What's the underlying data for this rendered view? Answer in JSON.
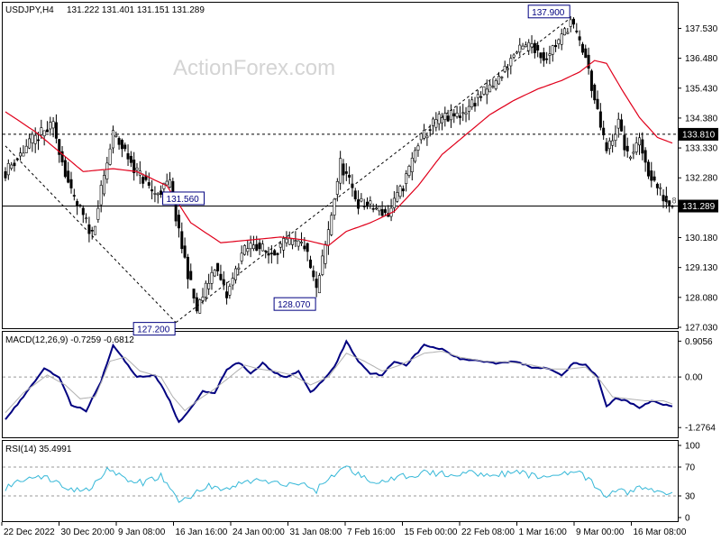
{
  "header": {
    "symbol": "USDJPY,H4",
    "ohlc": "131.222 131.401 131.151 131.289"
  },
  "watermark": "ActionForex.com",
  "colors": {
    "candle": "#000000",
    "ma": "#e0001b",
    "macd": "#000080",
    "signal": "#b0b0b0",
    "rsi": "#36b8d8",
    "label_border": "#000080",
    "badge_bg": "#000000",
    "badge_text": "#ffffff"
  },
  "chart_data": [
    {
      "type": "candlestick",
      "title": "USDJPY,H4 131.222 131.401 131.151 131.289",
      "x_tick_labels": [
        "22 Dec 2022",
        "30 Dec 20:00",
        "9 Jan 08:00",
        "16 Jan 16:00",
        "24 Jan 00:00",
        "31 Jan 08:00",
        "7 Feb 16:00",
        "15 Feb 00:00",
        "22 Feb 08:00",
        "1 Mar 16:00",
        "9 Mar 00:00",
        "16 Mar 08:00"
      ],
      "y_tick_labels": [
        "137.530",
        "136.480",
        "135.430",
        "134.380",
        "133.330",
        "132.280",
        "131.230",
        "130.180",
        "129.130",
        "128.080",
        "127.030"
      ],
      "ylim": [
        127.03,
        138.4
      ],
      "price_path_anchors": [
        [
          0,
          132.5
        ],
        [
          9,
          133.6
        ],
        [
          16,
          134.1
        ],
        [
          22,
          131.7
        ],
        [
          29,
          130.3
        ],
        [
          36,
          133.8
        ],
        [
          40,
          133.2
        ],
        [
          44,
          132.5
        ],
        [
          50,
          131.7
        ],
        [
          55,
          132.1
        ],
        [
          58,
          130.3
        ],
        [
          64,
          127.6
        ],
        [
          70,
          129.2
        ],
        [
          74,
          128.1
        ],
        [
          79,
          129.6
        ],
        [
          83,
          130.0
        ],
        [
          88,
          129.6
        ],
        [
          94,
          130.0
        ],
        [
          100,
          129.9
        ],
        [
          104,
          128.3
        ],
        [
          108,
          130.4
        ],
        [
          112,
          132.8
        ],
        [
          118,
          131.4
        ],
        [
          124,
          131.2
        ],
        [
          128,
          131.0
        ],
        [
          133,
          132.0
        ],
        [
          138,
          133.5
        ],
        [
          144,
          134.3
        ],
        [
          152,
          134.5
        ],
        [
          158,
          135.1
        ],
        [
          164,
          135.6
        ],
        [
          170,
          136.6
        ],
        [
          176,
          137.0
        ],
        [
          180,
          136.5
        ],
        [
          186,
          137.2
        ],
        [
          189,
          137.8
        ],
        [
          194,
          136.5
        ],
        [
          198,
          134.5
        ],
        [
          201,
          133.2
        ],
        [
          205,
          134.2
        ],
        [
          208,
          133.0
        ],
        [
          212,
          133.5
        ],
        [
          215,
          132.5
        ],
        [
          220,
          131.6
        ],
        [
          223,
          131.289
        ]
      ],
      "moving_average": {
        "anchors": [
          [
            0,
            134.6
          ],
          [
            10,
            133.9
          ],
          [
            18,
            133.2
          ],
          [
            26,
            132.5
          ],
          [
            36,
            132.6
          ],
          [
            44,
            132.5
          ],
          [
            54,
            132.0
          ],
          [
            62,
            130.7
          ],
          [
            72,
            130.0
          ],
          [
            82,
            130.1
          ],
          [
            92,
            130.2
          ],
          [
            100,
            130.1
          ],
          [
            108,
            129.9
          ],
          [
            114,
            130.4
          ],
          [
            122,
            130.7
          ],
          [
            130,
            131.1
          ],
          [
            138,
            132.0
          ],
          [
            146,
            133.1
          ],
          [
            154,
            133.8
          ],
          [
            162,
            134.5
          ],
          [
            170,
            135.0
          ],
          [
            178,
            135.4
          ],
          [
            186,
            135.7
          ],
          [
            192,
            136.0
          ],
          [
            197,
            136.4
          ],
          [
            201,
            136.3
          ],
          [
            206,
            135.4
          ],
          [
            212,
            134.4
          ],
          [
            218,
            133.7
          ],
          [
            223,
            133.5
          ]
        ]
      },
      "horizontal_levels": [
        {
          "value": 133.81,
          "label": "133.810",
          "style": "dashed"
        },
        {
          "value": 131.289,
          "label": "131.289",
          "style": "solid"
        }
      ],
      "trendlines": [
        {
          "from": [
            0,
            133.4
          ],
          "to": [
            57,
            127.2
          ]
        },
        {
          "from": [
            57,
            127.2
          ],
          "to": [
            189,
            137.9
          ]
        }
      ],
      "annotations": [
        {
          "bar": 189,
          "value": 137.9,
          "text": "137.900",
          "pos": "above-left"
        },
        {
          "bar": 52,
          "value": 131.56,
          "text": "131.560",
          "pos": "right"
        },
        {
          "bar": 57,
          "value": 127.2,
          "text": "127.200",
          "pos": "below-left"
        },
        {
          "bar": 104,
          "value": 128.07,
          "text": "128.070",
          "pos": "below-left"
        }
      ],
      "right_edge_note": "1.8"
    },
    {
      "type": "line",
      "title": "MACD(12,26,9) -0.7259 -0.6812",
      "y_tick_labels": [
        "0.9056",
        "0.00",
        "-1.2764"
      ],
      "ylim": [
        -1.5,
        1.05
      ],
      "zero_line": 0.0,
      "series": [
        {
          "name": "MACD",
          "anchors": [
            [
              0,
              -1.05
            ],
            [
              5,
              -0.6
            ],
            [
              13,
              0.22
            ],
            [
              18,
              0.0
            ],
            [
              22,
              -0.7
            ],
            [
              27,
              -0.85
            ],
            [
              32,
              -0.1
            ],
            [
              36,
              0.8
            ],
            [
              40,
              0.4
            ],
            [
              44,
              0.0
            ],
            [
              50,
              0.05
            ],
            [
              55,
              -0.6
            ],
            [
              58,
              -1.15
            ],
            [
              62,
              -0.8
            ],
            [
              66,
              -0.35
            ],
            [
              70,
              -0.4
            ],
            [
              74,
              0.2
            ],
            [
              78,
              0.37
            ],
            [
              82,
              0.1
            ],
            [
              86,
              0.35
            ],
            [
              90,
              0.1
            ],
            [
              94,
              0.0
            ],
            [
              98,
              0.15
            ],
            [
              102,
              -0.4
            ],
            [
              106,
              -0.1
            ],
            [
              110,
              0.25
            ],
            [
              114,
              0.9
            ],
            [
              118,
              0.4
            ],
            [
              122,
              0.1
            ],
            [
              126,
              0.05
            ],
            [
              130,
              0.4
            ],
            [
              134,
              0.3
            ],
            [
              140,
              0.8
            ],
            [
              146,
              0.7
            ],
            [
              152,
              0.45
            ],
            [
              158,
              0.42
            ],
            [
              164,
              0.35
            ],
            [
              170,
              0.4
            ],
            [
              176,
              0.25
            ],
            [
              182,
              0.22
            ],
            [
              186,
              0.05
            ],
            [
              190,
              0.35
            ],
            [
              194,
              0.3
            ],
            [
              198,
              0.0
            ],
            [
              201,
              -0.75
            ],
            [
              204,
              -0.55
            ],
            [
              208,
              -0.6
            ],
            [
              212,
              -0.8
            ],
            [
              216,
              -0.6
            ],
            [
              220,
              -0.7
            ],
            [
              223,
              -0.73
            ]
          ]
        },
        {
          "name": "Signal",
          "anchors": [
            [
              0,
              -0.9
            ],
            [
              6,
              -0.4
            ],
            [
              14,
              0.05
            ],
            [
              20,
              -0.2
            ],
            [
              25,
              -0.55
            ],
            [
              30,
              -0.5
            ],
            [
              35,
              0.4
            ],
            [
              40,
              0.5
            ],
            [
              45,
              0.15
            ],
            [
              52,
              0.0
            ],
            [
              56,
              -0.5
            ],
            [
              60,
              -0.85
            ],
            [
              65,
              -0.55
            ],
            [
              70,
              -0.3
            ],
            [
              75,
              0.0
            ],
            [
              80,
              0.3
            ],
            [
              85,
              0.2
            ],
            [
              90,
              0.15
            ],
            [
              96,
              0.05
            ],
            [
              102,
              -0.2
            ],
            [
              108,
              0.0
            ],
            [
              114,
              0.6
            ],
            [
              120,
              0.4
            ],
            [
              126,
              0.15
            ],
            [
              132,
              0.3
            ],
            [
              140,
              0.6
            ],
            [
              146,
              0.65
            ],
            [
              152,
              0.5
            ],
            [
              160,
              0.4
            ],
            [
              168,
              0.38
            ],
            [
              176,
              0.3
            ],
            [
              182,
              0.2
            ],
            [
              188,
              0.2
            ],
            [
              194,
              0.25
            ],
            [
              199,
              -0.1
            ],
            [
              203,
              -0.5
            ],
            [
              208,
              -0.55
            ],
            [
              214,
              -0.6
            ],
            [
              220,
              -0.6
            ],
            [
              223,
              -0.68
            ]
          ]
        }
      ]
    },
    {
      "type": "line",
      "title": "RSI(14) 35.4991",
      "y_tick_labels": [
        "100",
        "70",
        "30",
        "0"
      ],
      "ylim": [
        0,
        100
      ],
      "levels": [
        70,
        30
      ],
      "series": [
        {
          "name": "RSI(14)",
          "anchors": [
            [
              0,
              40
            ],
            [
              8,
              58
            ],
            [
              16,
              52
            ],
            [
              22,
              38
            ],
            [
              28,
              40
            ],
            [
              34,
              68
            ],
            [
              40,
              52
            ],
            [
              46,
              48
            ],
            [
              52,
              58
            ],
            [
              58,
              22
            ],
            [
              62,
              30
            ],
            [
              68,
              45
            ],
            [
              74,
              38
            ],
            [
              80,
              50
            ],
            [
              86,
              52
            ],
            [
              92,
              45
            ],
            [
              98,
              48
            ],
            [
              104,
              38
            ],
            [
              108,
              55
            ],
            [
              114,
              70
            ],
            [
              120,
              55
            ],
            [
              126,
              48
            ],
            [
              132,
              56
            ],
            [
              140,
              62
            ],
            [
              148,
              60
            ],
            [
              156,
              62
            ],
            [
              164,
              60
            ],
            [
              172,
              62
            ],
            [
              180,
              55
            ],
            [
              186,
              62
            ],
            [
              190,
              65
            ],
            [
              196,
              50
            ],
            [
              200,
              28
            ],
            [
              204,
              38
            ],
            [
              208,
              35
            ],
            [
              212,
              42
            ],
            [
              216,
              38
            ],
            [
              220,
              34
            ],
            [
              223,
              35.5
            ]
          ]
        }
      ]
    }
  ]
}
